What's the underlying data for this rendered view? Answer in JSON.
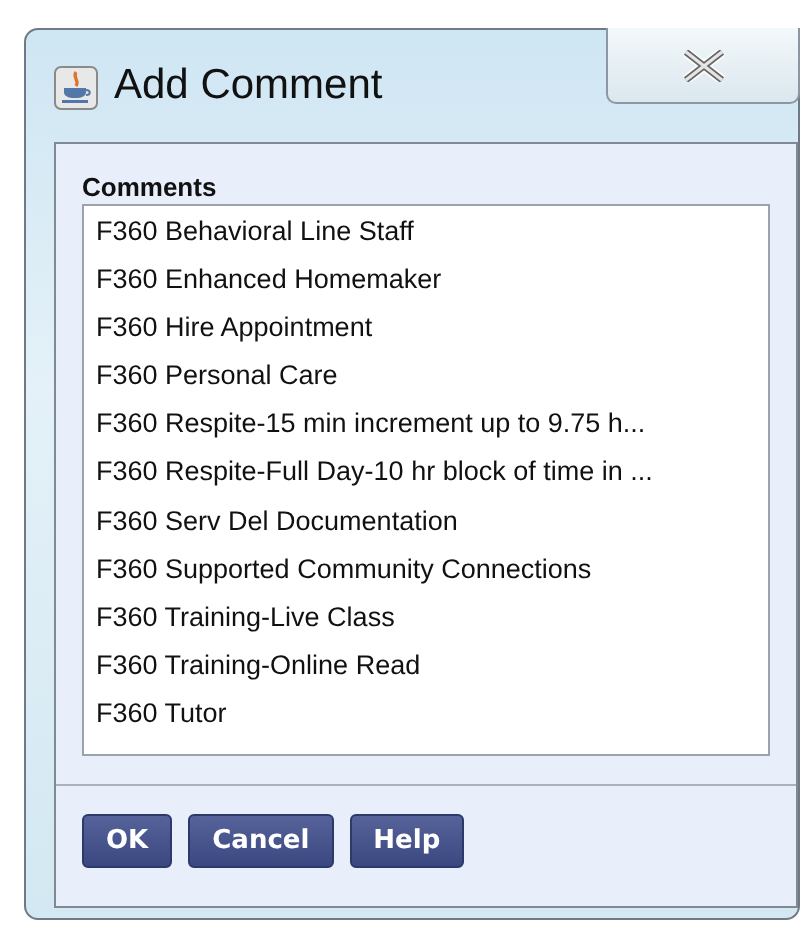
{
  "window": {
    "title": "Add Comment"
  },
  "comments": {
    "label": "Comments",
    "items": [
      {
        "text": "F360 Behavioral Line Staff"
      },
      {
        "text": "F360 Enhanced Homemaker"
      },
      {
        "text": "F360 Hire Appointment"
      },
      {
        "text": "F360 Personal Care"
      },
      {
        "text": "F360 Respite-15 min increment up to 9.75 h..."
      },
      {
        "text": "F360 Respite-Full Day-10 hr block of time in ..."
      },
      {
        "text": "F360 Serv Del Documentation"
      },
      {
        "text": "F360 Supported Community Connections"
      },
      {
        "text": "F360 Training-Live Class"
      },
      {
        "text": "F360 Training-Online Read"
      },
      {
        "text": "F360 Tutor"
      }
    ]
  },
  "buttons": [
    "OK",
    "Cancel",
    "Help"
  ]
}
